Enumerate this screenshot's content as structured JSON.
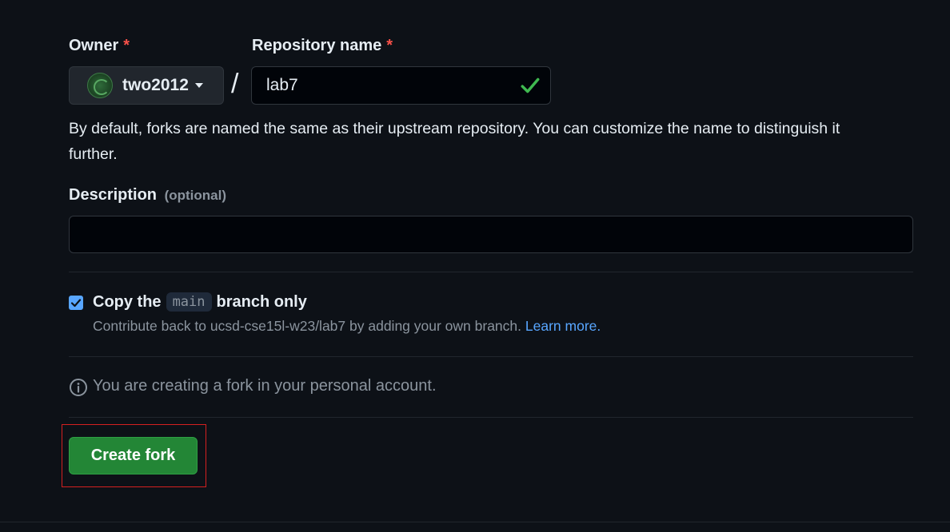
{
  "owner": {
    "label": "Owner",
    "required_mark": "*",
    "selected": "two2012"
  },
  "repository": {
    "label": "Repository name",
    "required_mark": "*",
    "value": "lab7",
    "separator": "/"
  },
  "name_hint": "By default, forks are named the same as their upstream repository. You can customize the name to distinguish it further.",
  "description": {
    "label": "Description",
    "optional_text": "(optional)",
    "value": ""
  },
  "copy_branch": {
    "checked": true,
    "title_prefix": "Copy the",
    "branch": "main",
    "title_suffix": "branch only",
    "subtext": "Contribute back to ucsd-cse15l-w23/lab7 by adding your own branch.",
    "learn_more": "Learn more."
  },
  "info_message": "You are creating a fork in your personal account.",
  "create_button": "Create fork",
  "colors": {
    "background": "#0d1117",
    "accent_green": "#238636",
    "link_blue": "#58a6ff",
    "required_red": "#f85149",
    "highlight_red": "#d52020"
  }
}
